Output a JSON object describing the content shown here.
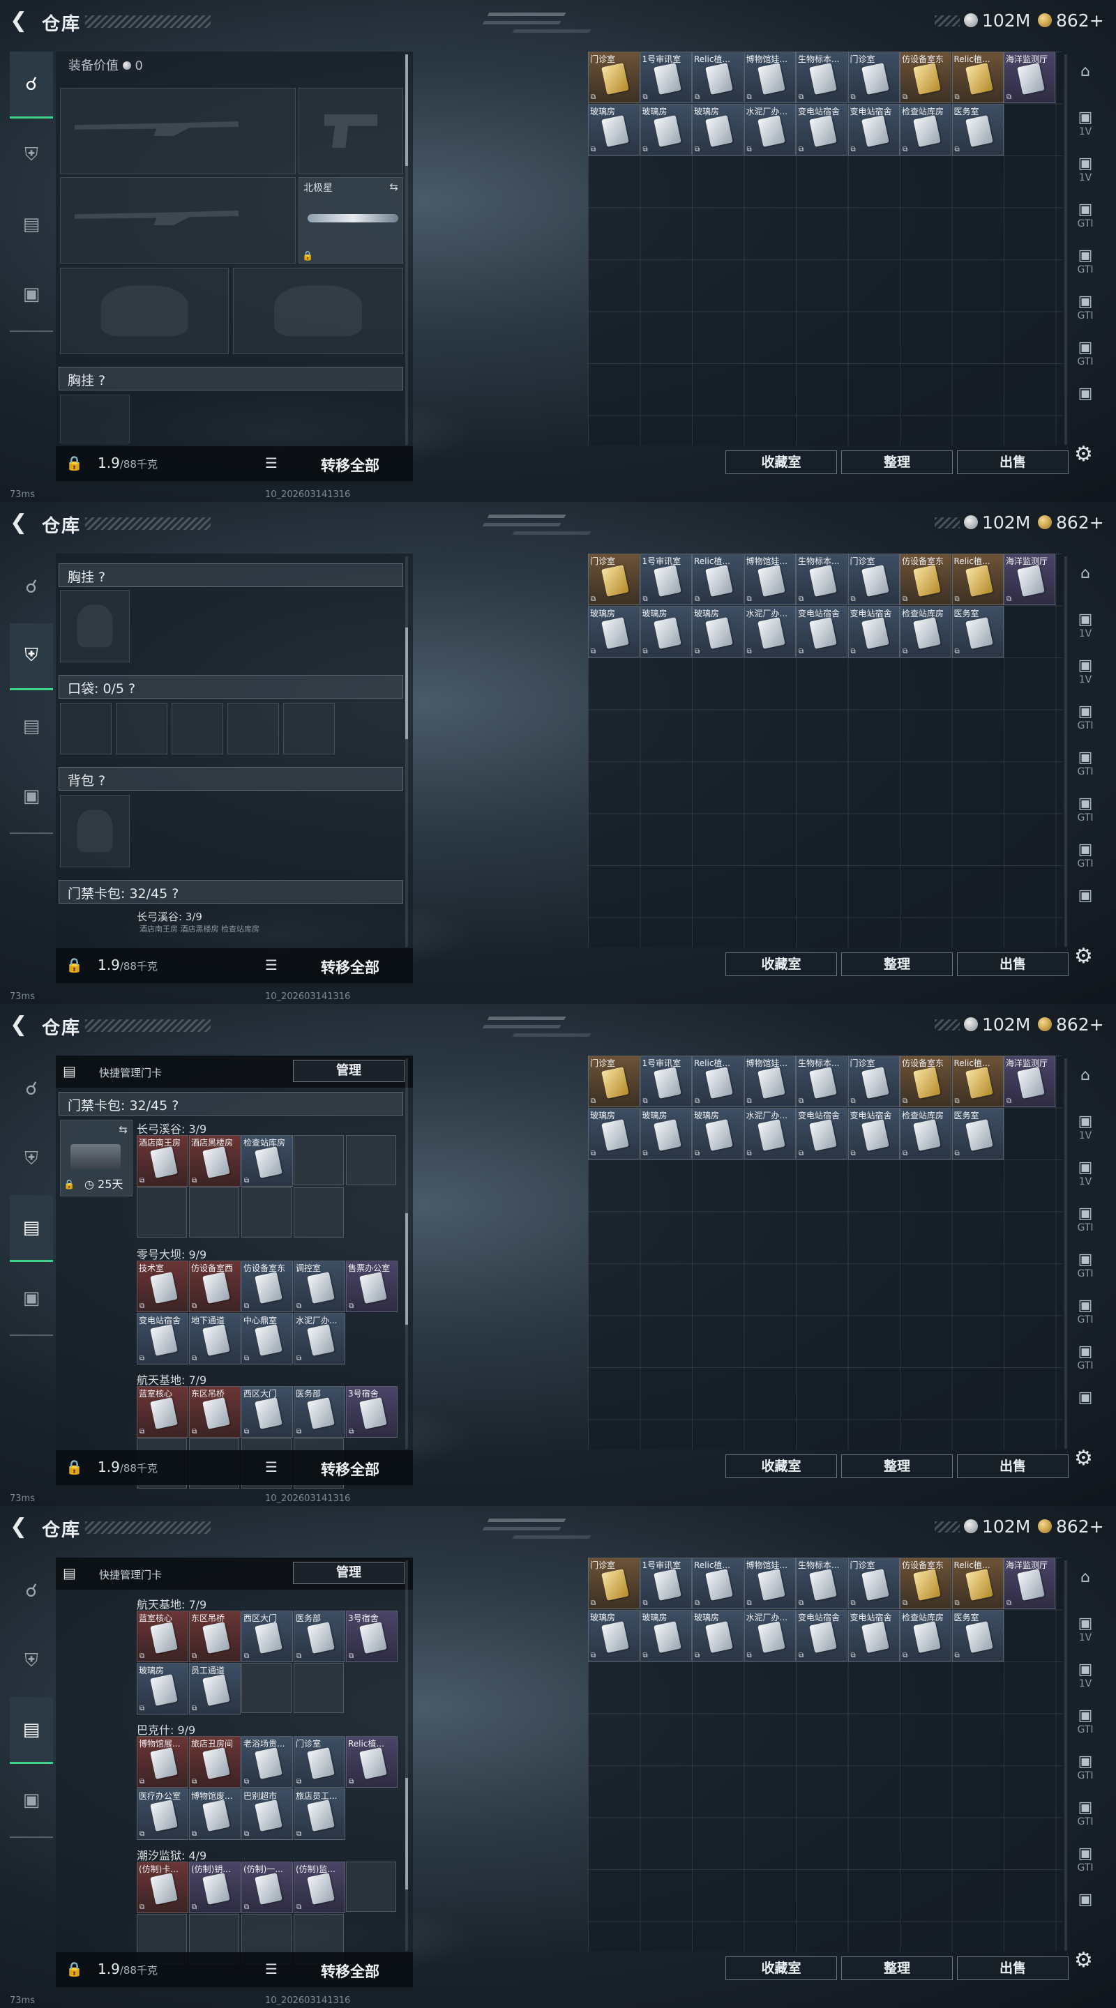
{
  "common": {
    "title": "仓库",
    "back_icon": "back-arrow-icon",
    "currency_silver": "102M",
    "currency_gold": "862+",
    "weight": "1.9",
    "weight_max": "/88千克",
    "transfer_all": "转移全部",
    "btn_collection": "收藏室",
    "btn_sort": "整理",
    "btn_sell": "出售",
    "ping": "73ms",
    "build_id": "10_202603141316",
    "manage_label": "快捷管理门卡",
    "manage_btn": "管理",
    "right_rows": [
      [
        "门诊室",
        "1号审讯室",
        "Relic植...",
        "博物馆娃...",
        "生物标本...",
        "门诊室",
        "仿设备室东",
        "Relic植...",
        "海洋监测厅"
      ],
      [
        "玻璃房",
        "玻璃房",
        "玻璃房",
        "水泥厂办...",
        "变电站宿舍",
        "变电站宿舍",
        "检查站库房",
        "医务室"
      ]
    ],
    "right_side_tags": [
      "",
      "1V",
      "1V",
      "GTI",
      "GTI",
      "GTI",
      "GTI",
      ""
    ]
  },
  "panel1": {
    "equipment_value_label": "装备价值",
    "equipment_value": "0",
    "knife_label": "北极星",
    "section_chest": "胸挂 ?"
  },
  "panel2": {
    "section_chest": "胸挂 ?",
    "section_pocket": "口袋: 0/5 ?",
    "section_backpack": "背包 ?",
    "section_keycard": "门禁卡包: 32/45 ?",
    "sub_group": "长弓溪谷: 3/9",
    "sub_cards": "酒店南王房   酒店黑楼房   检查站库房"
  },
  "panel3": {
    "section_keycard": "门禁卡包: 32/45 ?",
    "timer": "25天",
    "groups": [
      {
        "name": "长弓溪谷: 3/9",
        "cards": [
          "酒店南王房",
          "酒店黑楼房",
          "检查站库房"
        ]
      },
      {
        "name": "零号大坝: 9/9",
        "cards": [
          "技术室",
          "仿设备室西",
          "仿设备室东",
          "调控室",
          "售票办公室",
          "变电站宿舍",
          "地下通道",
          "中心鼎室",
          "水泥厂办..."
        ]
      },
      {
        "name": "航天基地: 7/9",
        "cards": [
          "蓝室核心",
          "东区吊桥",
          "西区大门",
          "医务部",
          "3号宿舍"
        ]
      }
    ]
  },
  "panel4": {
    "groups": [
      {
        "name": "航天基地: 7/9",
        "cards": [
          "蓝室核心",
          "东区吊桥",
          "西区大门",
          "医务部",
          "3号宿舍",
          "玻璃房",
          "员工通道"
        ]
      },
      {
        "name": "巴克什: 9/9",
        "cards": [
          "博物馆展...",
          "旅店丑房间",
          "老浴场贵...",
          "门诊室",
          "Relic植...",
          "医疗办公室",
          "博物馆废...",
          "巴别超市",
          "旅店员工..."
        ]
      },
      {
        "name": "潮汐监狱: 4/9",
        "cards": [
          "(仿制)卡...",
          "(仿制)钥...",
          "(仿制)一...",
          "(仿制)监..."
        ]
      }
    ]
  }
}
